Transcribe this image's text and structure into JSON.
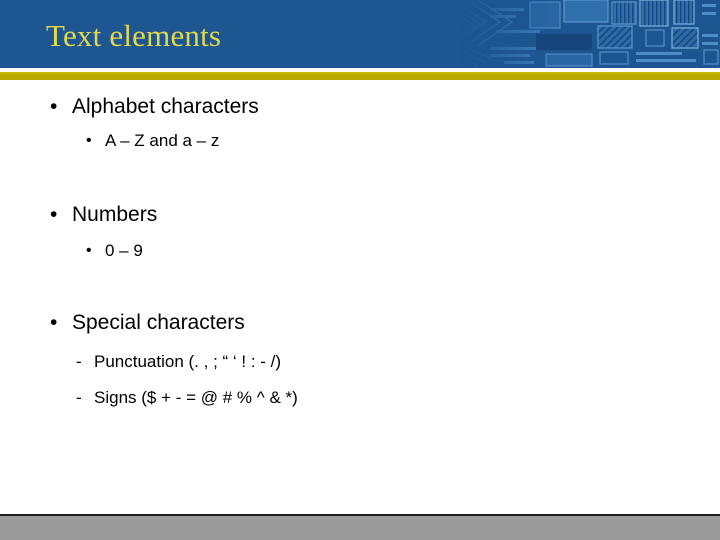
{
  "slide": {
    "title": "Text elements",
    "colors": {
      "header_blue": "#1e5692",
      "title_yellow": "#e3d84a",
      "gold_band": "#b9a800",
      "footer_gray": "#9a9a9a",
      "body_background": "#ffffff",
      "text_black": "#000000"
    },
    "bullet_glyphs": {
      "level1": "•",
      "level2": "•",
      "level3": "-"
    },
    "content": [
      {
        "level": 1,
        "text": "Alphabet characters"
      },
      {
        "level": 2,
        "text": "A – Z and a – z"
      },
      {
        "level": 1,
        "text": "Numbers"
      },
      {
        "level": 2,
        "text": "0 – 9"
      },
      {
        "level": 1,
        "text": "Special characters"
      },
      {
        "level": 3,
        "text": "Punctuation (. ,  ; “ ‘ ! : -  /)"
      },
      {
        "level": 3,
        "text": "Signs ($ + - = @ # % ^ & *)"
      }
    ]
  }
}
